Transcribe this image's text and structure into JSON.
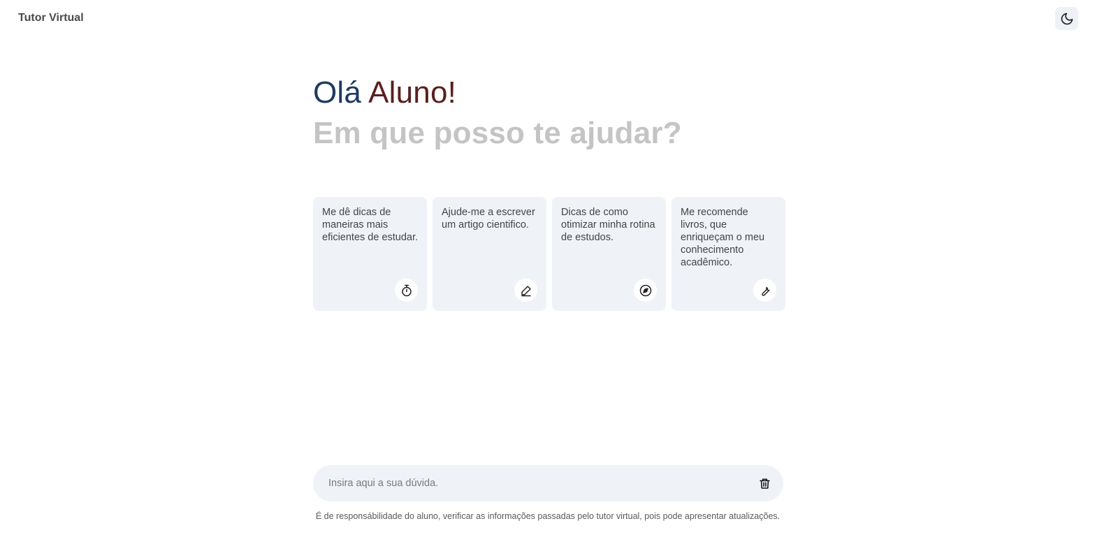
{
  "header": {
    "app_title": "Tutor Virtual",
    "theme_toggle_icon": "moon-icon"
  },
  "hero": {
    "greeting_hello": "Olá",
    "greeting_name": "Aluno!",
    "subtitle": "Em que posso te ajudar?"
  },
  "suggestions": [
    {
      "text": "Me dê dicas de maneiras mais eficientes de estudar.",
      "icon": "stopwatch-icon"
    },
    {
      "text": "Ajude-me a escrever um artigo cientifico.",
      "icon": "pencil-icon"
    },
    {
      "text": "Dicas de como otimizar minha rotina de estudos.",
      "icon": "compass-icon"
    },
    {
      "text": "Me recomende livros, que enriqueçam o meu conhecimento acadêmico.",
      "icon": "wrench-icon"
    }
  ],
  "chat_input": {
    "placeholder": "Insira aqui a sua dúvida.",
    "value": "",
    "clear_icon": "trash-icon"
  },
  "footer": {
    "disclaimer": "É de responsábilidade do aluno, verificar as informações passadas pelo tutor virtual, pois pode apresentar atualizações."
  },
  "colors": {
    "greeting_hello": "#1e3a5f",
    "greeting_name": "#5b1f1f",
    "subtitle": "#c4c4c4",
    "card_background": "#eff2f7"
  }
}
